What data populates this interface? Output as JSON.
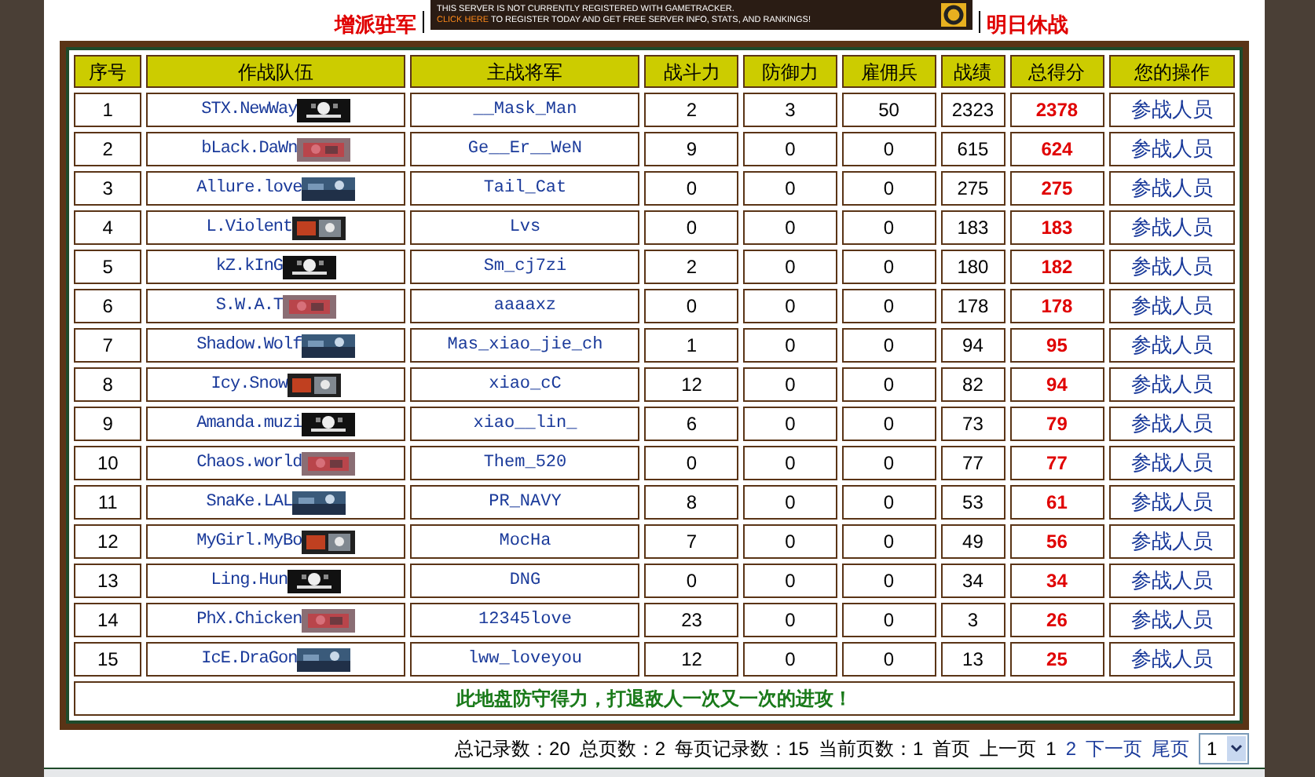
{
  "top_links": [
    {
      "label": "增派驻军"
    },
    {
      "label": "明日休战"
    }
  ],
  "banner": {
    "line_1": "THIS SERVER IS NOT CURRENTLY REGISTERED WITH GAMETRACKER.",
    "highlight": "CLICK HERE",
    "line_2": " TO REGISTER TODAY AND GET FREE SERVER INFO, STATS, AND RANKINGS!"
  },
  "table": {
    "columns": [
      "序号",
      "作战队伍",
      "主战将军",
      "战斗力",
      "防御力",
      "雇佣兵",
      "战绩",
      "总得分",
      "您的操作"
    ],
    "rows": [
      {
        "rank": "1",
        "team": "STX.NewWay",
        "general": "__Mask_Man",
        "attack": "2",
        "defense": "3",
        "mercenaries": "50",
        "record": "2323",
        "score": "2378",
        "action": "参战人员"
      },
      {
        "rank": "2",
        "team": "bLack.DaWn",
        "general": "Ge__Er__WeN",
        "attack": "9",
        "defense": "0",
        "mercenaries": "0",
        "record": "615",
        "score": "624",
        "action": "参战人员"
      },
      {
        "rank": "3",
        "team": "Allure.love",
        "general": "Tail_Cat",
        "attack": "0",
        "defense": "0",
        "mercenaries": "0",
        "record": "275",
        "score": "275",
        "action": "参战人员"
      },
      {
        "rank": "4",
        "team": "L.Violent",
        "general": "Lvs",
        "attack": "0",
        "defense": "0",
        "mercenaries": "0",
        "record": "183",
        "score": "183",
        "action": "参战人员"
      },
      {
        "rank": "5",
        "team": "kZ.kInG",
        "general": "Sm_cj7zi",
        "attack": "2",
        "defense": "0",
        "mercenaries": "0",
        "record": "180",
        "score": "182",
        "action": "参战人员"
      },
      {
        "rank": "6",
        "team": "S.W.A.T",
        "general": "aaaaxz",
        "attack": "0",
        "defense": "0",
        "mercenaries": "0",
        "record": "178",
        "score": "178",
        "action": "参战人员"
      },
      {
        "rank": "7",
        "team": "Shadow.Wolf",
        "general": "Mas_xiao_jie_ch",
        "attack": "1",
        "defense": "0",
        "mercenaries": "0",
        "record": "94",
        "score": "95",
        "action": "参战人员"
      },
      {
        "rank": "8",
        "team": "Icy.Snow",
        "general": "xiao_cC",
        "attack": "12",
        "defense": "0",
        "mercenaries": "0",
        "record": "82",
        "score": "94",
        "action": "参战人员"
      },
      {
        "rank": "9",
        "team": "Amanda.muzi",
        "general": "xiao__lin_",
        "attack": "6",
        "defense": "0",
        "mercenaries": "0",
        "record": "73",
        "score": "79",
        "action": "参战人员"
      },
      {
        "rank": "10",
        "team": "Chaos.world",
        "general": "Them_520",
        "attack": "0",
        "defense": "0",
        "mercenaries": "0",
        "record": "77",
        "score": "77",
        "action": "参战人员"
      },
      {
        "rank": "11",
        "team": "SnaKe.LAL",
        "general": "PR_NAVY",
        "attack": "8",
        "defense": "0",
        "mercenaries": "0",
        "record": "53",
        "score": "61",
        "action": "参战人员"
      },
      {
        "rank": "12",
        "team": "MyGirl.MyBo",
        "general": "MocHa",
        "attack": "7",
        "defense": "0",
        "mercenaries": "0",
        "record": "49",
        "score": "56",
        "action": "参战人员"
      },
      {
        "rank": "13",
        "team": "Ling.Hun",
        "general": "DNG",
        "attack": "0",
        "defense": "0",
        "mercenaries": "0",
        "record": "34",
        "score": "34",
        "action": "参战人员"
      },
      {
        "rank": "14",
        "team": "PhX.Chicken",
        "general": "12345love",
        "attack": "23",
        "defense": "0",
        "mercenaries": "0",
        "record": "3",
        "score": "26",
        "action": "参战人员"
      },
      {
        "rank": "15",
        "team": "IcE.DraGon",
        "general": "lww_loveyou",
        "attack": "12",
        "defense": "0",
        "mercenaries": "0",
        "record": "13",
        "score": "25",
        "action": "参战人员"
      }
    ],
    "footer": "此地盘防守得力，打退敌人一次又一次的进攻！"
  },
  "pager": {
    "stats": [
      "总记录数：20",
      "总页数：2",
      "每页记录数：15",
      "当前页数：1"
    ],
    "links": [
      {
        "label": "首页",
        "enabled": false
      },
      {
        "label": "上一页",
        "enabled": false
      },
      {
        "label": "1",
        "enabled": false
      },
      {
        "label": "2",
        "enabled": true
      },
      {
        "label": "下一页",
        "enabled": true
      },
      {
        "label": "尾页",
        "enabled": true
      }
    ],
    "page_select": "1"
  }
}
